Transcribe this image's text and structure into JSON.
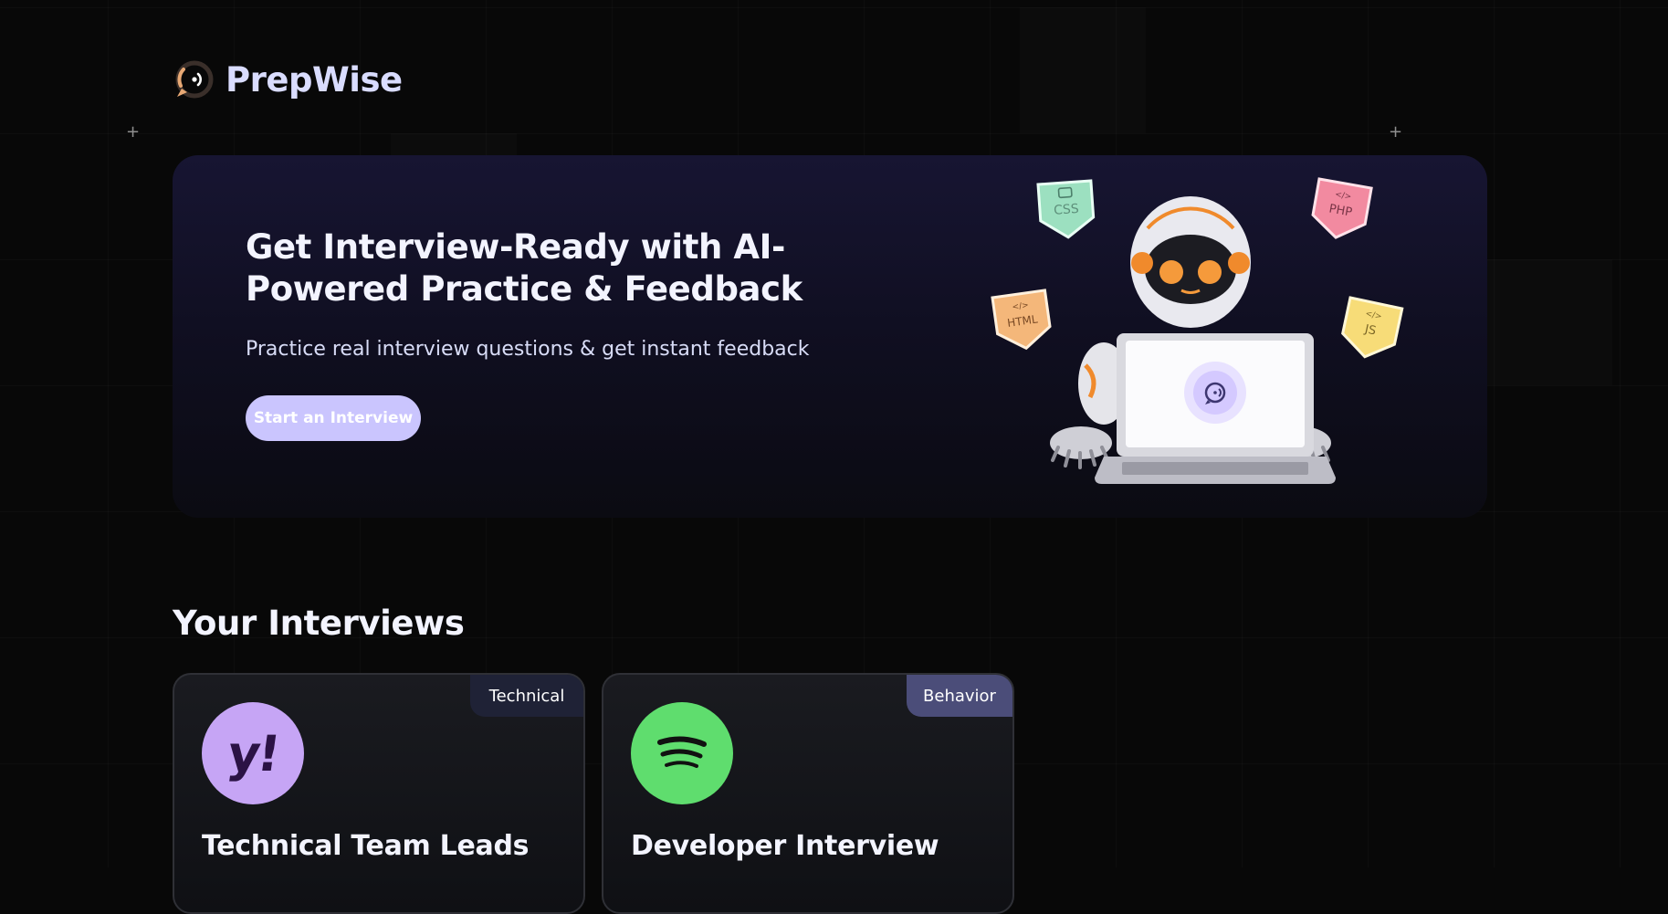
{
  "brand": {
    "name": "PrepWise"
  },
  "hero": {
    "title": "Get Interview-Ready with AI-Powered Practice & Feedback",
    "subtitle": "Practice real interview questions & get instant feedback",
    "cta_label": "Start an Interview",
    "tags": [
      "CSS",
      "PHP",
      "HTML",
      "JS"
    ]
  },
  "interviews_section": {
    "title": "Your Interviews",
    "cards": [
      {
        "badge": "Technical",
        "logo_text": "y!",
        "title": "Technical Team Leads"
      },
      {
        "badge": "Behavior",
        "title": "Developer Interview"
      }
    ]
  },
  "colors": {
    "background": "#080808",
    "brand_text": "#d9dcff",
    "cta_bg": "#cac5fe",
    "badge_technical": "#1f2236",
    "badge_behavior": "#4b4d79",
    "yahoo_bg": "#c6a5f5",
    "spotify_bg": "#5fdd6e"
  }
}
